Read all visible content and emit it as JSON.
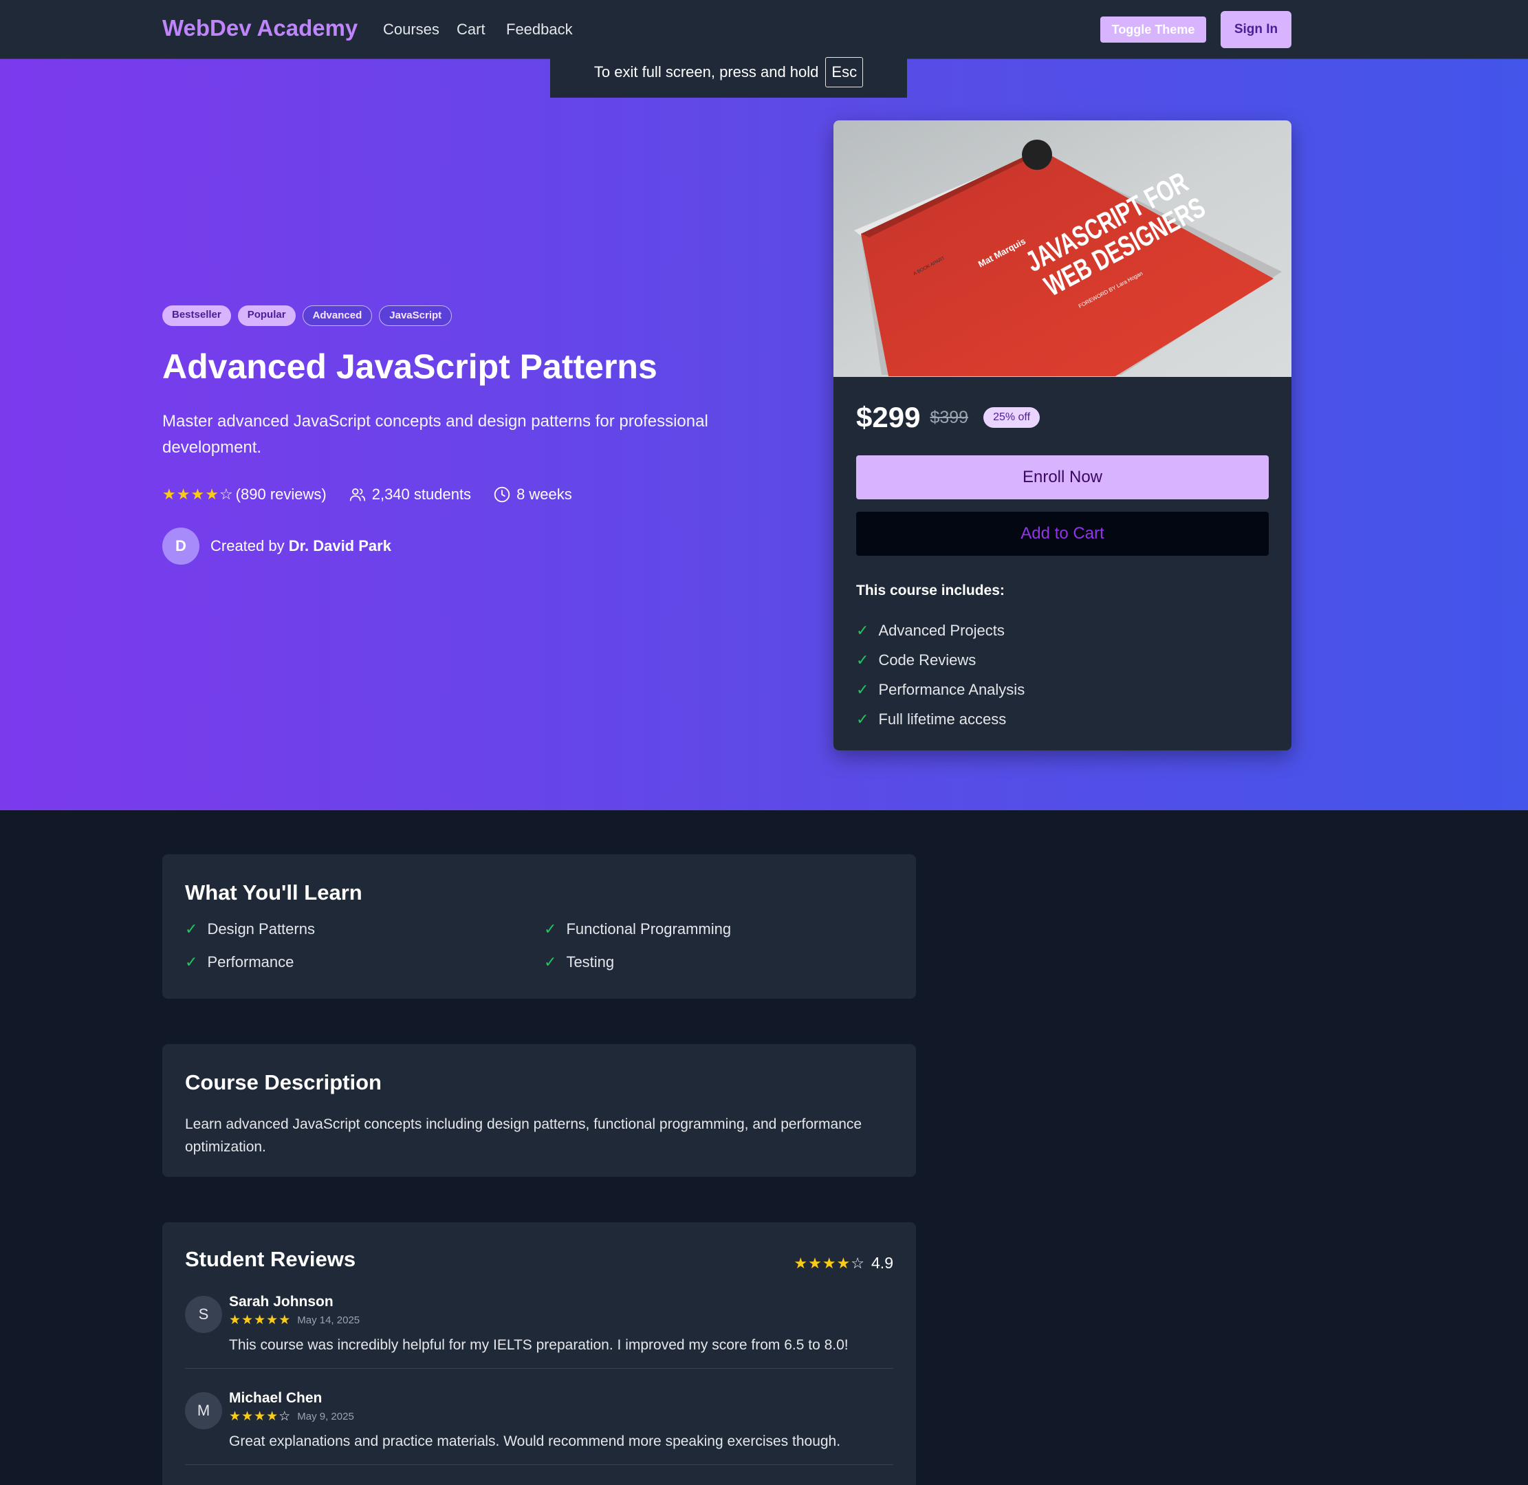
{
  "nav": {
    "brand": "WebDev Academy",
    "links": [
      "Courses",
      "Cart",
      "Feedback"
    ],
    "toggle_theme": "Toggle Theme",
    "sign_in": "Sign In"
  },
  "fullscreen_toast": {
    "message": "To exit full screen, press and hold",
    "key": "Esc"
  },
  "hero": {
    "tags": [
      "Bestseller",
      "Popular",
      "Advanced",
      "JavaScript"
    ],
    "title": "Advanced JavaScript Patterns",
    "subtitle": "Master advanced JavaScript concepts and design patterns for professional development.",
    "rating_stars": 4,
    "reviews": "(890 reviews)",
    "students": "2,340 students",
    "duration": "8 weeks",
    "creator_initial": "D",
    "created_by_label": "Created by",
    "creator_name": "Dr. David Park"
  },
  "card": {
    "image_alt": "JavaScript for Web Designers book cover",
    "image_text": {
      "author": "Mat Marquis",
      "title_line1": "JAVASCRIPT FOR",
      "title_line2": "WEB DESIGNERS",
      "foreword": "FOREWORD BY Lara Hogan",
      "series": "A BOOK APART"
    },
    "price": "$299",
    "old_price": "$399",
    "discount": "25% off",
    "enroll": "Enroll Now",
    "add_to_cart": "Add to Cart",
    "includes_title": "This course includes:",
    "includes": [
      "Advanced Projects",
      "Code Reviews",
      "Performance Analysis",
      "Full lifetime access"
    ]
  },
  "learn": {
    "title": "What You'll Learn",
    "items": [
      "Design Patterns",
      "Functional Programming",
      "Performance",
      "Testing"
    ]
  },
  "description": {
    "title": "Course Description",
    "text": "Learn advanced JavaScript concepts including design patterns, functional programming, and performance optimization."
  },
  "reviews": {
    "title": "Student Reviews",
    "average": "4.9",
    "average_stars": 4,
    "items": [
      {
        "initial": "S",
        "name": "Sarah Johnson",
        "stars": 5,
        "date": "May 14, 2025",
        "text": "This course was incredibly helpful for my IELTS preparation. I improved my score from 6.5 to 8.0!"
      },
      {
        "initial": "M",
        "name": "Michael Chen",
        "stars": 4,
        "date": "May 9, 2025",
        "text": "Great explanations and practice materials. Would recommend more speaking exercises though."
      }
    ]
  },
  "colors": {
    "accent": "#d8b4fe",
    "brand": "#c084fc",
    "star": "#facc15",
    "check": "#22c55e",
    "page_bg": "#111827",
    "card_bg": "#1f2937"
  }
}
